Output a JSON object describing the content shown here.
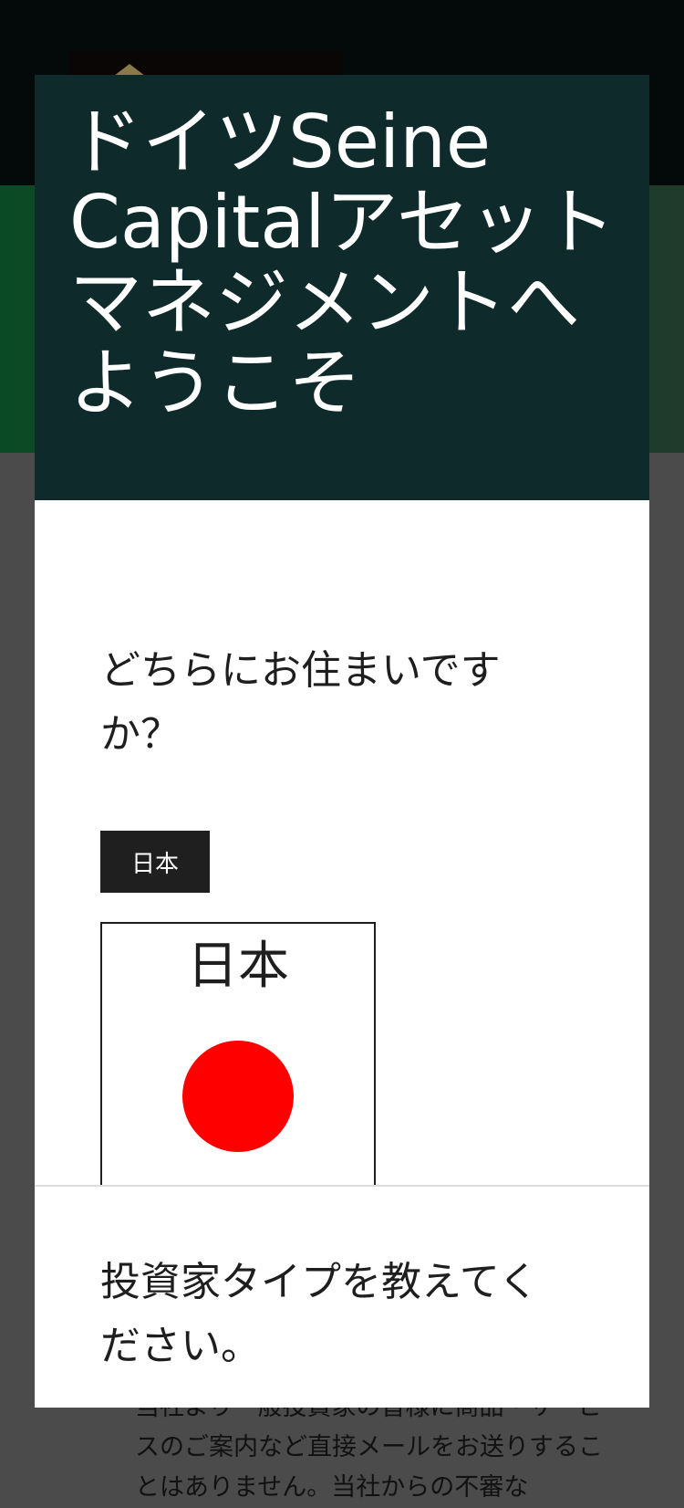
{
  "background": {
    "text": "当社より一般投資家の皆様に商品・サービスのご案内など直接メールをお送りすることはありません。当社からの不審な"
  },
  "modal": {
    "title": "ドイツSeine Capitalアセットマネジメントへようこそ",
    "residence": {
      "question": "どちらにお住まいですか？",
      "selected_tag": "日本",
      "country_option": {
        "label": "日本",
        "flag_icon": "japan-flag-icon",
        "flag_color": "#ff0000"
      }
    },
    "investor_type": {
      "question": "投資家タイプを教えてください。"
    }
  },
  "colors": {
    "header_bg": "#0f2a2b",
    "topbar_bg": "#040a0a",
    "hero_green": "#0a4a24",
    "overlay": "#4b4b4b",
    "tag_bg": "#1f1f1f"
  }
}
